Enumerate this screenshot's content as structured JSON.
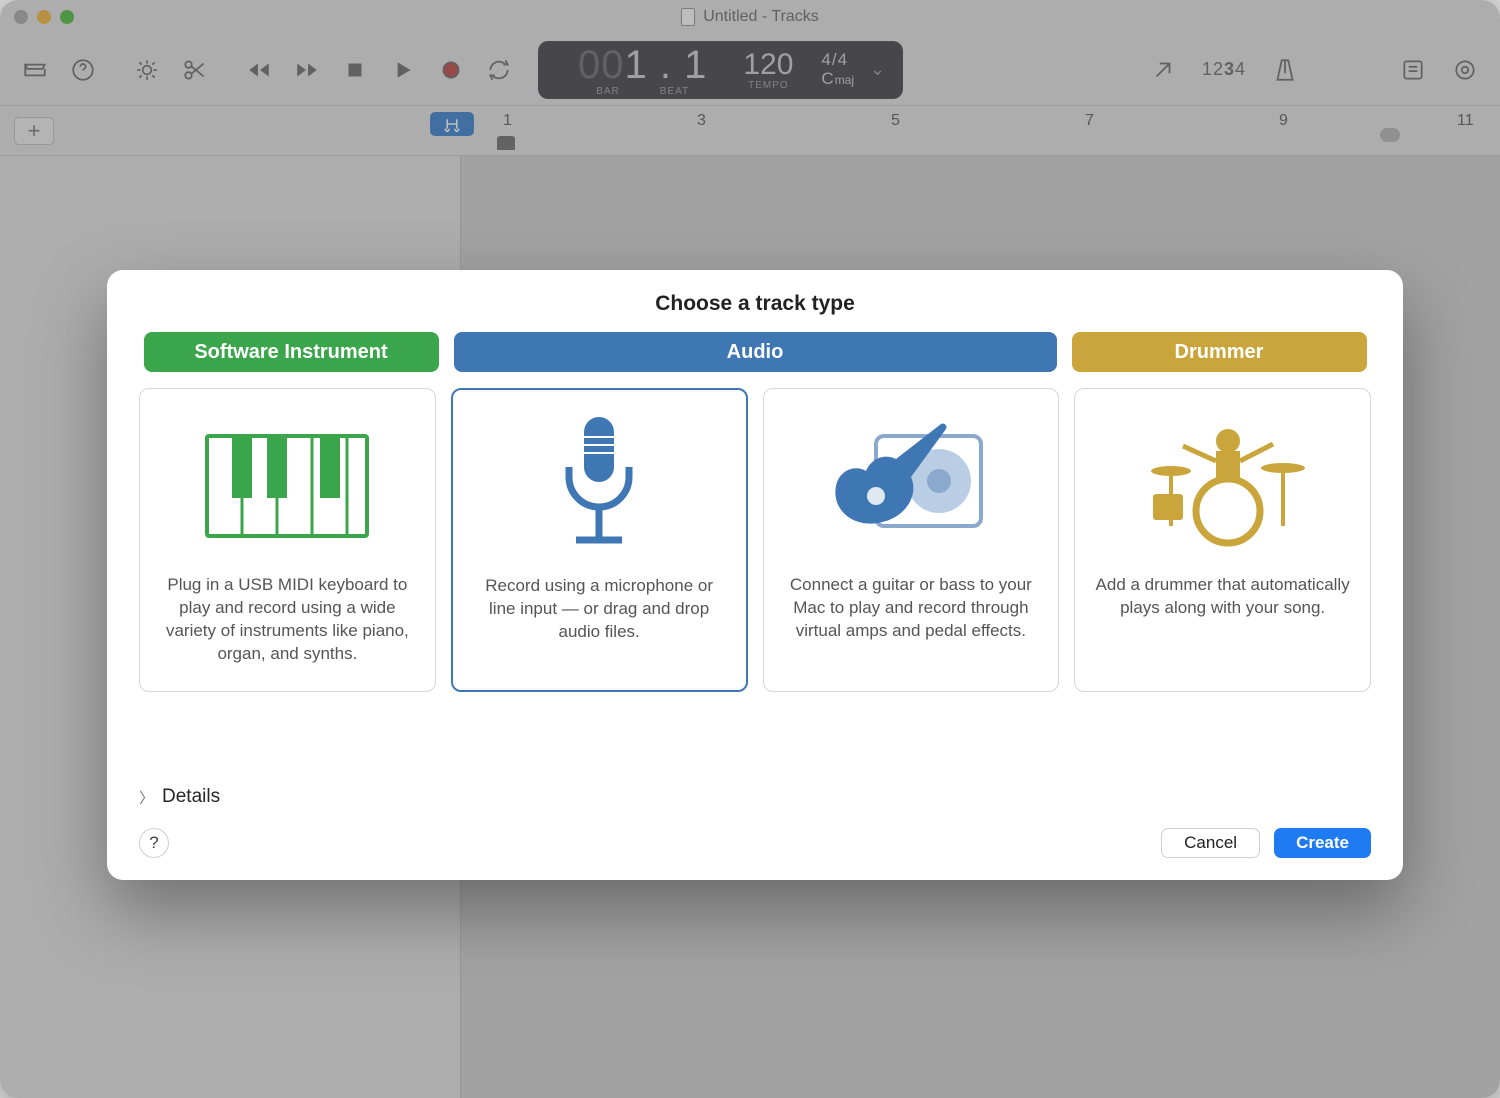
{
  "window": {
    "title": "Untitled - Tracks"
  },
  "transport": {
    "bar_faint": "00",
    "bar_beat": "1 . 1",
    "bar_label": "BAR",
    "beat_label": "BEAT",
    "tempo": "120",
    "tempo_label": "TEMPO",
    "timesig": "4/4",
    "key": "C",
    "key_mode": "maj"
  },
  "counter_mode": "1234",
  "ruler": {
    "numbers": [
      "1",
      "3",
      "5",
      "7",
      "9",
      "11"
    ]
  },
  "modal": {
    "title": "Choose a track type",
    "tabs": {
      "software": "Software Instrument",
      "audio": "Audio",
      "drummer": "Drummer"
    },
    "cards": {
      "software": "Plug in a USB MIDI keyboard to play and record using a wide variety of instruments like piano, organ, and synths.",
      "mic": "Record using a microphone or line input — or drag and drop audio files.",
      "guitar": "Connect a guitar or bass to your Mac to play and record through virtual amps and pedal effects.",
      "drummer": "Add a drummer that automatically plays along with your song."
    },
    "details": "Details",
    "cancel": "Cancel",
    "create": "Create"
  }
}
